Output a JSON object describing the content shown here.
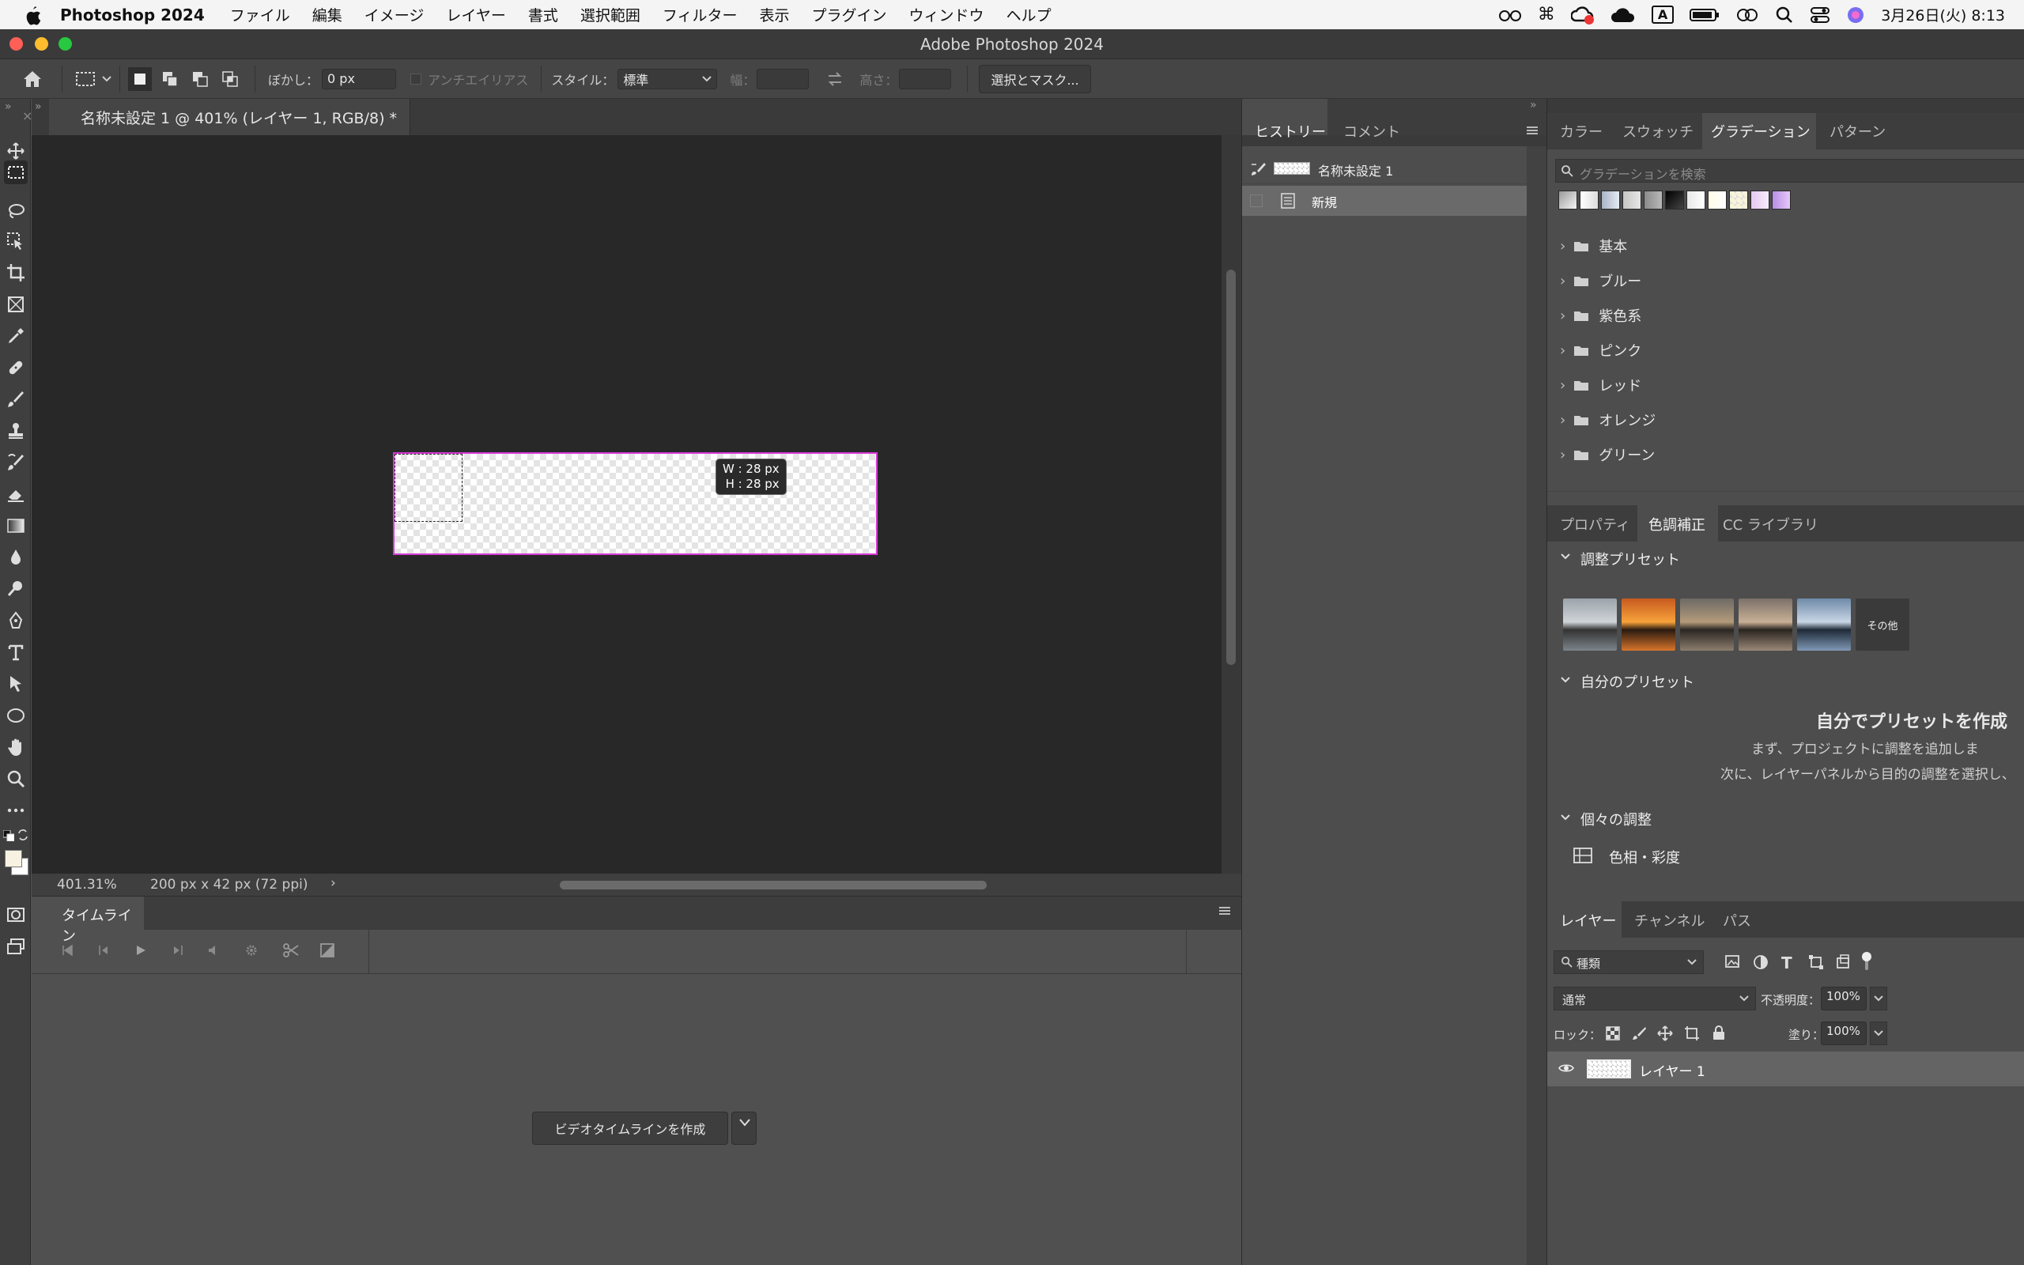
{
  "menubar": {
    "app_name": "Photoshop 2024",
    "items": [
      "ファイル",
      "編集",
      "イメージ",
      "レイヤー",
      "書式",
      "選択範囲",
      "フィルター",
      "表示",
      "プラグイン",
      "ウィンドウ",
      "ヘルプ"
    ],
    "input_mode": "A",
    "clock": "3月26日(火)  8:13"
  },
  "window": {
    "title": "Adobe Photoshop 2024"
  },
  "options": {
    "feather_label": "ぼかし：",
    "feather_value": "0 px",
    "antialias_label": "アンチエイリアス",
    "style_label": "スタイル：",
    "style_value": "標準",
    "width_label": "幅：",
    "height_label": "高さ：",
    "select_mask_button": "選択とマスク..."
  },
  "document": {
    "tab_title": "名称未設定 1 @ 401% (レイヤー 1, RGB/8) *",
    "zoom": "401.31%",
    "info": "200 px x 42 px (72 ppi)",
    "tooltip_w": "W : 28 px",
    "tooltip_h": "H : 28 px"
  },
  "timeline": {
    "tab": "タイムライン",
    "create_button": "ビデオタイムラインを作成"
  },
  "history_panel": {
    "tabs": [
      "ヒストリー",
      "コメント"
    ],
    "snapshot_label": "名称未設定 1",
    "items": [
      "新規"
    ]
  },
  "gradient_panel": {
    "tabs": [
      "カラー",
      "スウォッチ",
      "グラデーション",
      "パターン"
    ],
    "search_placeholder": "グラデーションを検索",
    "swatch_colors": [
      "#9a9a9a",
      "#ffffff",
      "#c9d1dc",
      "#b0b0b0",
      "#8a8a8a",
      "#000000",
      "#e8e8e8",
      "#fffbe6",
      "#f7f3d9",
      "#e6c9f0",
      "#cfa3ef"
    ],
    "folders": [
      "基本",
      "ブルー",
      "紫色系",
      "ピンク",
      "レッド",
      "オレンジ",
      "グリーン"
    ]
  },
  "adjustments_panel": {
    "tabs": [
      "プロパティ",
      "色調補正",
      "CC ライブラリ"
    ],
    "presets_header": "調整プリセット",
    "more_label": "その他",
    "my_presets_header": "自分のプリセット",
    "my_presets_title": "自分でプリセットを作成",
    "my_presets_line1": "まず、プロジェクトに調整を追加しま",
    "my_presets_line2": "次に、レイヤーパネルから目的の調整を選択し、",
    "individual_header": "個々の調整",
    "individual_item": "色相・彩度"
  },
  "layers_panel": {
    "tabs": [
      "レイヤー",
      "チャンネル",
      "パス"
    ],
    "filter_value": "種類",
    "blend_mode": "通常",
    "opacity_label": "不透明度：",
    "opacity_value": "100%",
    "lock_label": "ロック：",
    "fill_label": "塗り：",
    "fill_value": "100%",
    "layer_name": "レイヤー 1"
  }
}
